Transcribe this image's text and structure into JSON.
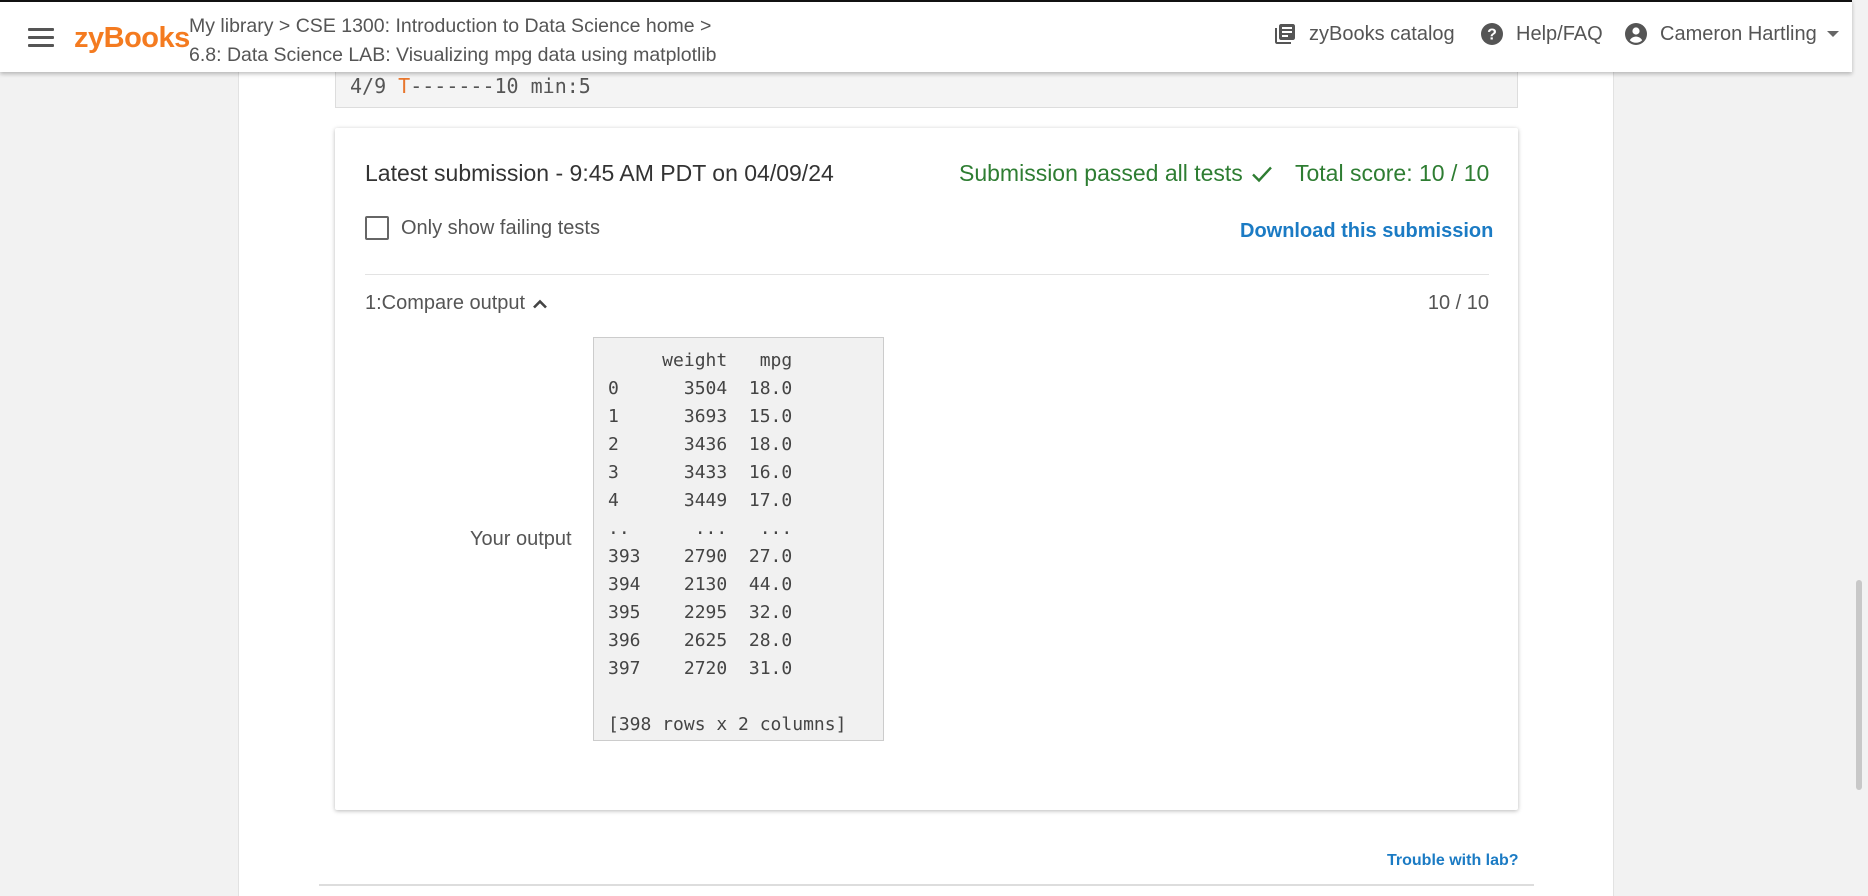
{
  "header": {
    "logo": "zyBooks",
    "breadcrumb_line1": "My library > CSE 1300: Introduction to Data Science home >",
    "breadcrumb_line2": "6.8: Data Science LAB: Visualizing mpg data using matplotlib",
    "catalog_label": "zyBooks catalog",
    "help_label": "Help/FAQ",
    "user_name": "Cameron Hartling"
  },
  "code_strip": {
    "prefix": "4/9 ",
    "highlight": "T",
    "suffix": "-------10 min:5"
  },
  "submission": {
    "latest": "Latest submission - 9:45 AM PDT on 04/09/24",
    "passed": "Submission passed all tests",
    "total_score": "Total score: 10 / 10",
    "only_failing_label": "Only show failing tests",
    "download_label": "Download this submission",
    "test_name": "1:Compare output",
    "test_score": "10 / 10",
    "your_output_label": "Your output",
    "output_lines": [
      "     weight   mpg",
      "0      3504  18.0",
      "1      3693  15.0",
      "2      3436  18.0",
      "3      3433  16.0",
      "4      3449  17.0",
      "..      ...   ...",
      "393    2790  27.0",
      "394    2130  44.0",
      "395    2295  32.0",
      "396    2625  28.0",
      "397    2720  31.0",
      "",
      "[398 rows x 2 columns]"
    ]
  },
  "footer": {
    "trouble_label": "Trouble with lab?"
  },
  "colors": {
    "brand": "#f47b20",
    "success": "#2e7d32",
    "link": "#1b7bc4"
  }
}
